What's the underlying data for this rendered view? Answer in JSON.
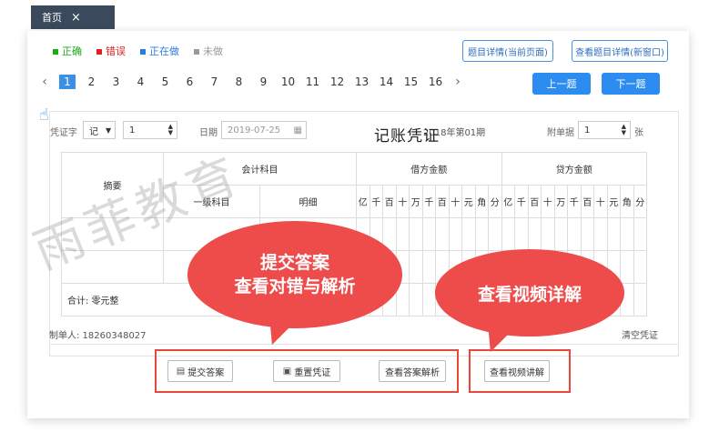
{
  "tab": {
    "label": "首页",
    "close": "×"
  },
  "legend": [
    {
      "label": "正确",
      "color": "#1aaa1a"
    },
    {
      "label": "错误",
      "color": "#e02020"
    },
    {
      "label": "正在做",
      "color": "#2a7ae2"
    },
    {
      "label": "未做",
      "color": "#999999"
    }
  ],
  "detail_buttons": {
    "current": "题目详情(当前页面)",
    "new_window": "查看题目详情(新窗口)"
  },
  "pager": {
    "prev": "‹",
    "next": "›",
    "current": "1",
    "pages": [
      "1",
      "2",
      "3",
      "4",
      "5",
      "6",
      "7",
      "8",
      "9",
      "10",
      "11",
      "12",
      "13",
      "14",
      "15",
      "16"
    ]
  },
  "nav": {
    "prev": "上一题",
    "next": "下一题"
  },
  "voucher": {
    "type_label": "凭证字",
    "type_value": "记",
    "number_value": "1",
    "date_label": "日期",
    "date_value": "2019-07-25",
    "title": "记账凭证",
    "period": "2018年第01期",
    "attach_label": "附单据",
    "attach_value": "1",
    "attach_unit": "张",
    "headers": {
      "summary": "摘要",
      "account": "会计科目",
      "debit": "借方金额",
      "credit": "贷方金额",
      "level1": "一级科目",
      "detail": "明细"
    },
    "digits": [
      "亿",
      "千",
      "百",
      "十",
      "万",
      "千",
      "百",
      "十",
      "元",
      "角",
      "分"
    ],
    "total": "合计: 零元整",
    "maker": "制单人: 18260348027",
    "clear": "清空凭证"
  },
  "actions": {
    "submit": "提交答案",
    "reset": "重置凭证",
    "analysis": "查看答案解析",
    "video": "查看视频讲解"
  },
  "watermark": "雨菲教育",
  "bubbles": {
    "b1_line1": "提交答案",
    "b1_line2": "查看对错与解析",
    "b2": "查看视频详解"
  }
}
